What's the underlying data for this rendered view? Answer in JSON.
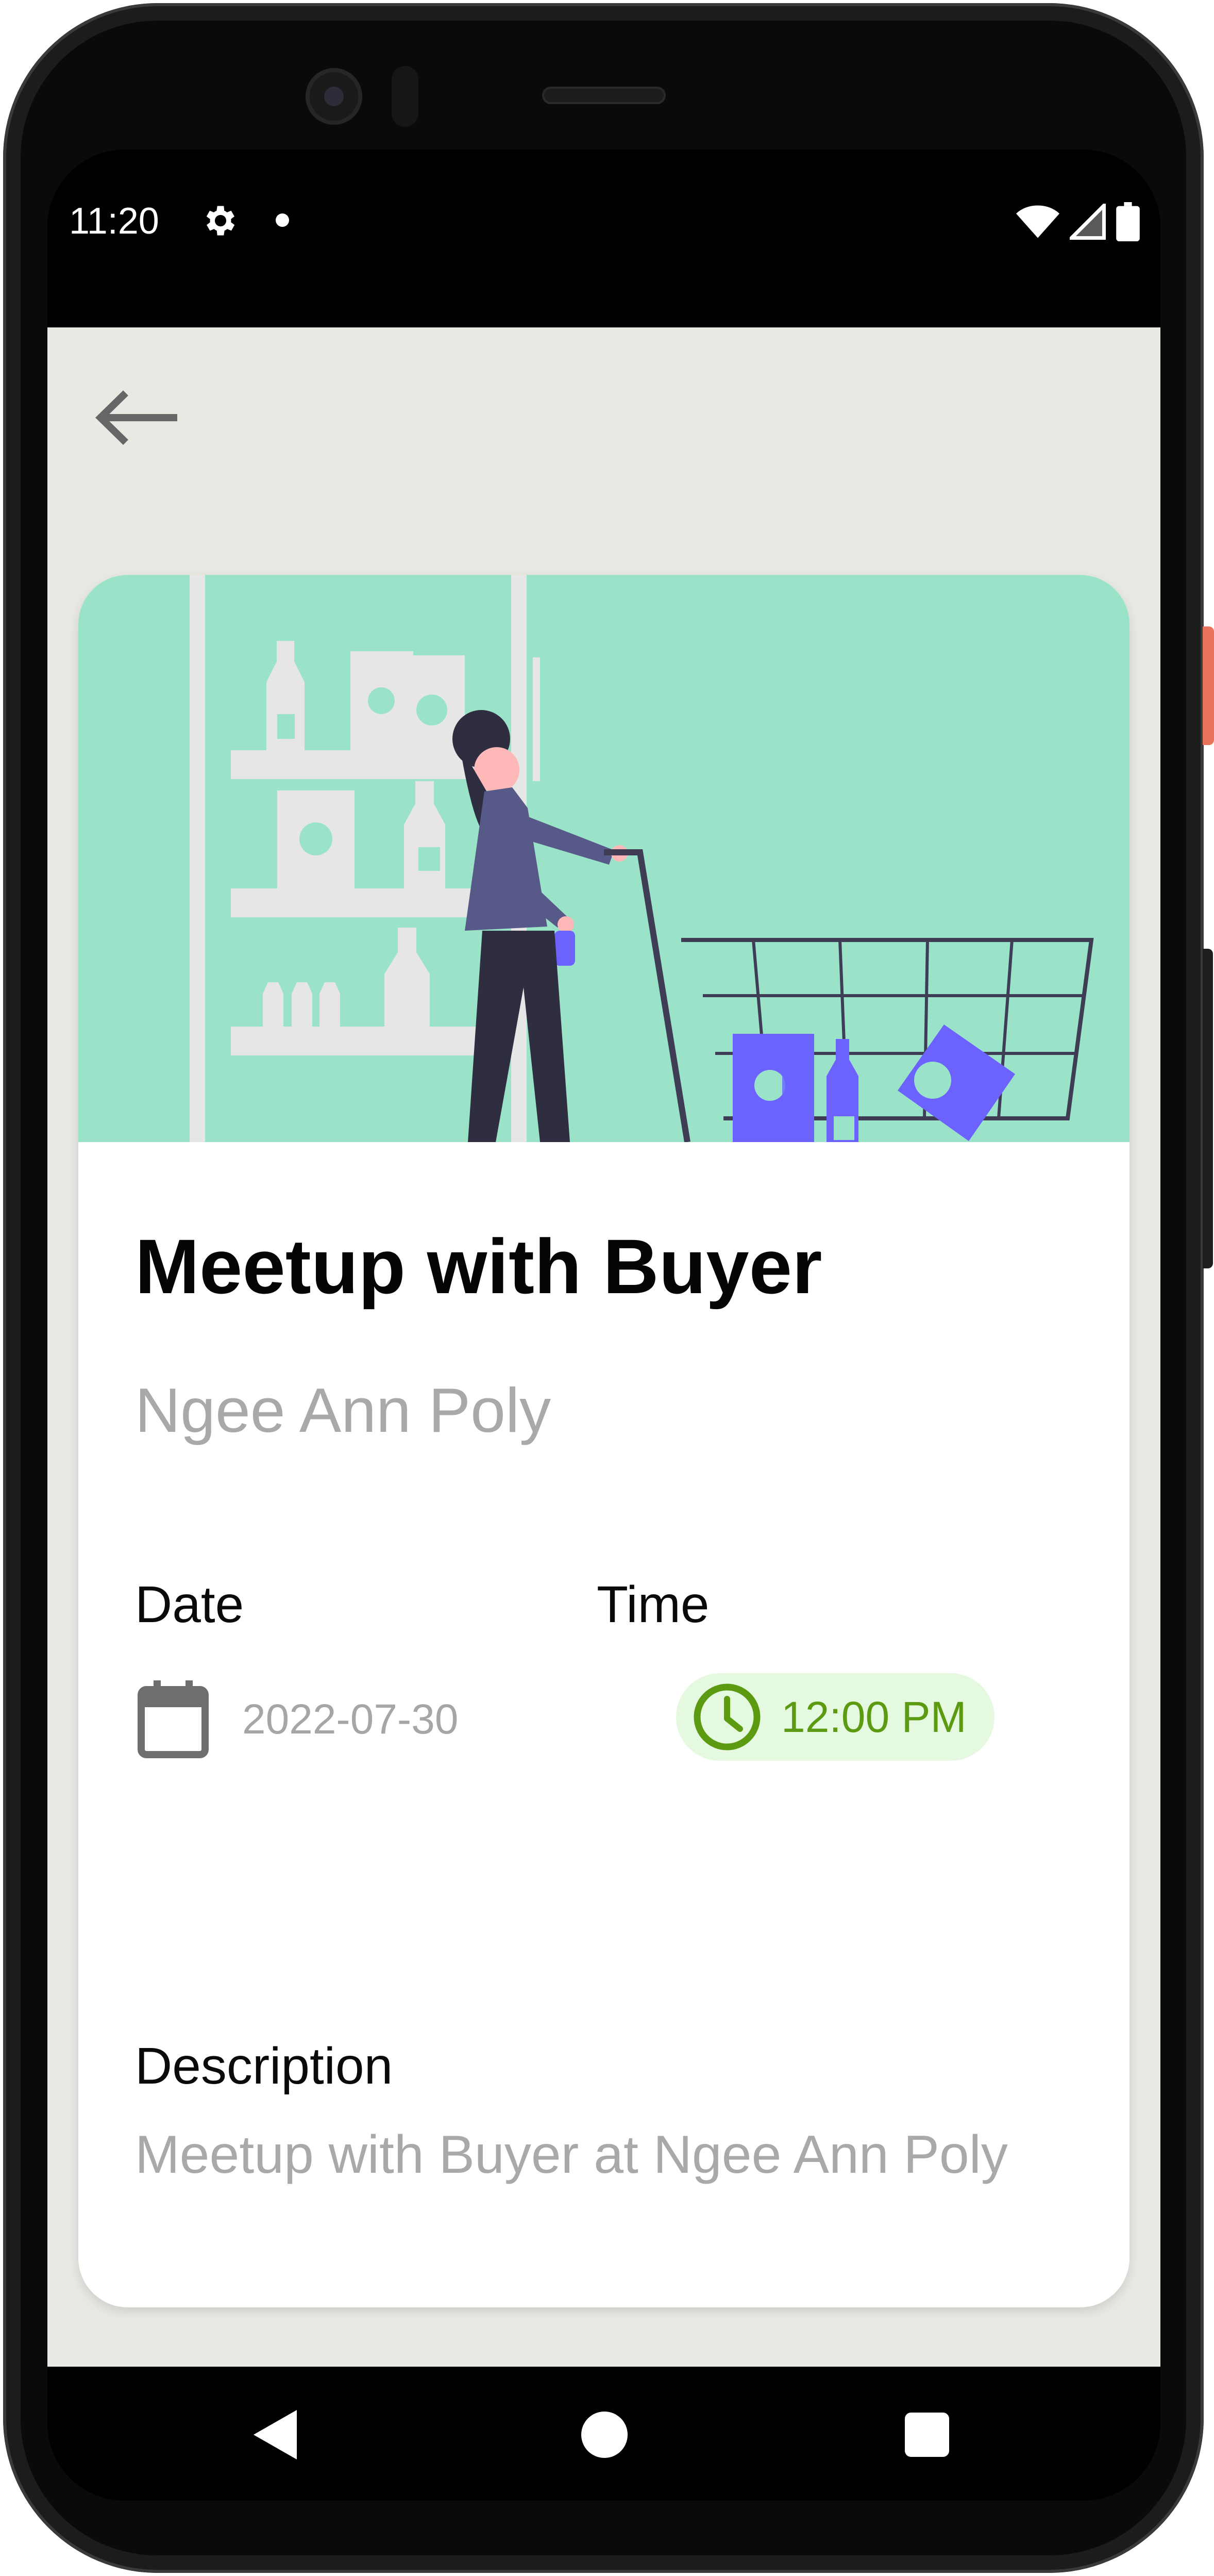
{
  "status_bar": {
    "time": "11:20",
    "icons": [
      "settings-gear-icon",
      "notification-dot-icon",
      "wifi-icon",
      "cellular-signal-icon",
      "battery-icon"
    ]
  },
  "app_bar": {
    "back_icon": "arrow-left-icon"
  },
  "event": {
    "title": "Meetup with Buyer",
    "location": "Ngee Ann Poly",
    "date_label": "Date",
    "date_value": "2022-07-30",
    "date_icon": "calendar-icon",
    "time_label": "Time",
    "time_value": "12:00 PM",
    "time_icon": "clock-icon",
    "description_label": "Description",
    "description_text": "Meetup with Buyer at Ngee Ann Poly"
  },
  "hero_image": {
    "subject": "shopping-cart-illustration",
    "background_color": "#9be3c8",
    "accent_color": "#6c63ff"
  },
  "colors": {
    "app_background": "#e9e9e4",
    "card_background": "#ffffff",
    "time_chip_background": "#e4f9df",
    "time_chip_text": "#5c9a12"
  },
  "nav_bar": {
    "icons": [
      "nav-back-icon",
      "nav-home-icon",
      "nav-recents-icon"
    ]
  }
}
